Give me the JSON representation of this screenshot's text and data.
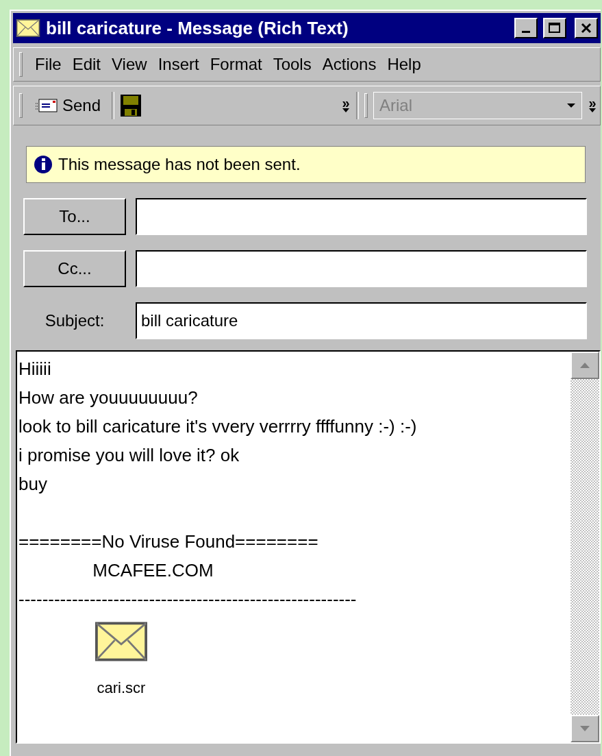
{
  "window": {
    "title": "bill caricature - Message (Rich Text)"
  },
  "menu": [
    "File",
    "Edit",
    "View",
    "Insert",
    "Format",
    "Tools",
    "Actions",
    "Help"
  ],
  "toolbar": {
    "send": "Send",
    "chevron_1": "»",
    "font": "Arial",
    "chevron_2": "»"
  },
  "info_bar": {
    "text": "This message has not been sent."
  },
  "fields": [
    {
      "kind": "button",
      "label": "To..."
    },
    {
      "kind": "button",
      "label": "Cc..."
    },
    {
      "kind": "label",
      "label": "Subject:",
      "value": "bill caricature"
    }
  ],
  "body": {
    "paragraphs": [
      [
        "Hiiiii",
        "How are youuuuuuuu?",
        "look to bill caricature it's vvery verrrry ffffunny :-) :-)",
        "i promise you will love it? ok",
        "buy"
      ],
      [
        "========No Viruse Found========",
        "               MCAFEE.COM",
        "---------------------------------------------------------"
      ]
    ],
    "attachment": {
      "name": "cari.scr"
    }
  }
}
